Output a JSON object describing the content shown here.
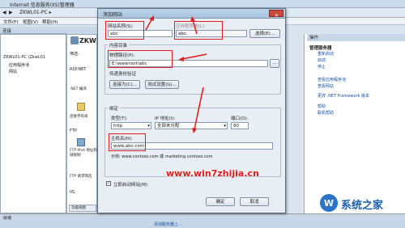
{
  "window": {
    "title": "Internet 信息服务(IIS)管理器",
    "address": "ZKWL01-PC ▸"
  },
  "menu": [
    "文件(F)",
    "视图(V)",
    "帮助(H)"
  ],
  "left": {
    "header": "连接",
    "tree": [
      "ZKWL01-PC (ZkwL01",
      "应用程序池",
      "网站"
    ]
  },
  "mid": {
    "title": "ZKW",
    "filter": "筛选:",
    "items": [
      "ASP.NET",
      ".NET 编译",
      "连接字符串",
      "FTP",
      "FTP IPv4 地址和域限制",
      "FTP 请求筛选",
      "IIS"
    ],
    "tab": "功能视图"
  },
  "right": {
    "header": "操作",
    "section1": "管理服务器",
    "actions1": [
      "重新启动",
      "启动",
      "停止"
    ],
    "actions2": [
      "查看应用程序池",
      "查看网站",
      "更改 .NET Framework 版本"
    ],
    "section_help": [
      "帮助",
      "联机帮助"
    ]
  },
  "status": "就绪",
  "dialog": {
    "title": "添加网站",
    "site_name_label": "网站名称(S):",
    "site_name_value": "abc",
    "app_pool_label": "应用程序池(L):",
    "app_pool_value": "abc",
    "select_button": "选择(E)...",
    "content_dir": "内容目录",
    "physical_path_label": "物理路径(P):",
    "physical_path_value": "E:\\wwwroot\\abc",
    "pass_auth": "传递身份验证",
    "connect_as_button": "连接为(C)...",
    "test_settings_button": "测试设置(G)...",
    "binding": "绑定",
    "type_label": "类型(T):",
    "type_value": "http",
    "ip_label": "IP 地址(I):",
    "ip_value": "全部未分配",
    "port_label": "端口(O):",
    "port_value": "80",
    "hostname_label": "主机名(H):",
    "hostname_value": "www.abc.com",
    "example": "示例: www.contoso.com 或 marketing.contoso.com",
    "start_immediately": "立即启动网站(M)",
    "ok_button": "确定",
    "cancel_button": "取消"
  },
  "watermark": "www.win7zhijia.cn",
  "brand": {
    "text": "系统之家",
    "logo": "W"
  },
  "bottom_link": "添加服务器上..."
}
